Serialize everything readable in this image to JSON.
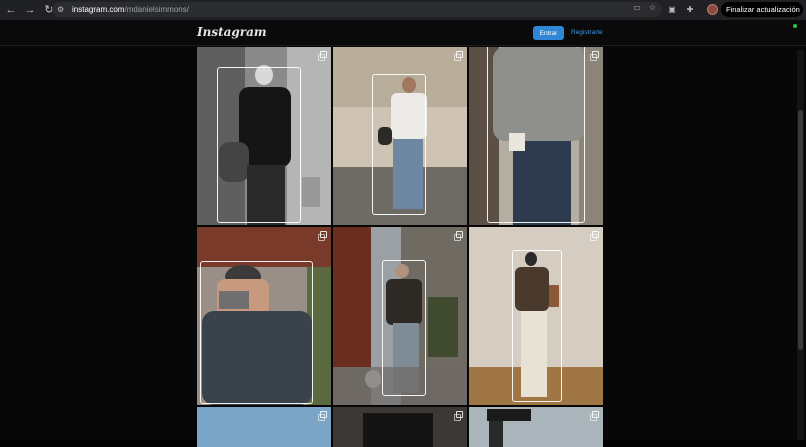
{
  "browser": {
    "url_host": "instagram.com",
    "url_path": "/mdanielsimmons/",
    "update_label": "Finalizar actualización",
    "icons": [
      "back-icon",
      "forward-icon",
      "reload-icon",
      "tune-icon",
      "cast-icon",
      "star-icon",
      "extension-icon",
      "puzzle-icon",
      "profile-avatar",
      "menu-dots-icon"
    ]
  },
  "header": {
    "logo": "Instagram",
    "login_label": "Entrar",
    "signup_label": "Registrarte"
  },
  "posts": [
    {
      "desc": "man in black sweater, monochrome"
    },
    {
      "desc": "man in denim jacket street"
    },
    {
      "desc": "man in grey henley with cup"
    },
    {
      "desc": "man with camera in cap"
    },
    {
      "desc": "man in leather jacket with dog"
    },
    {
      "desc": "man mirror selfie cream trousers"
    },
    {
      "desc": "sky"
    },
    {
      "desc": "dark doorway"
    },
    {
      "desc": "one way sign"
    }
  ],
  "colors": {
    "login_button": "#2f86d6",
    "signup_link": "#3b93e4"
  }
}
